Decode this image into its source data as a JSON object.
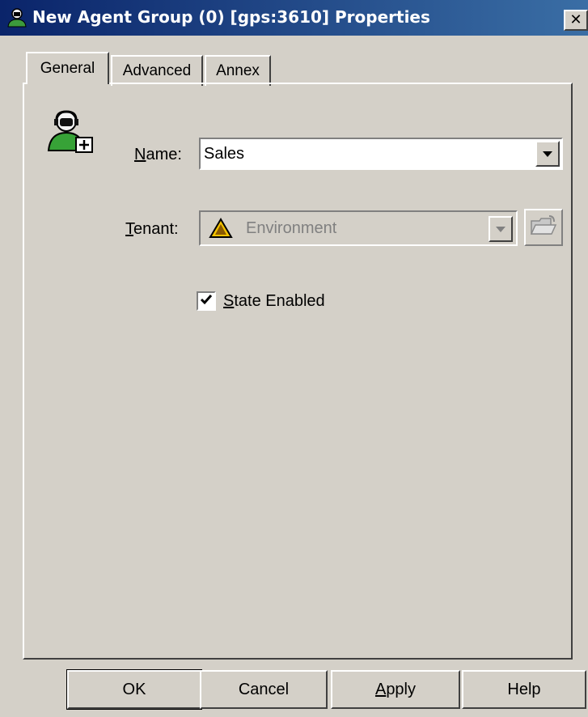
{
  "window": {
    "title": "New Agent Group (0) [gps:3610] Properties",
    "close_glyph": "✕"
  },
  "tabs": [
    {
      "label": "General",
      "selected": true
    },
    {
      "label": "Advanced",
      "selected": false
    },
    {
      "label": "Annex",
      "selected": false
    }
  ],
  "general": {
    "name_label_mnemonic": "N",
    "name_label_rest": "ame:",
    "name_value": "Sales",
    "tenant_label_mnemonic": "T",
    "tenant_label_rest": "enant:",
    "tenant_value": "Environment",
    "tenant_enabled": false,
    "state_enabled_mnemonic": "S",
    "state_enabled_rest": "tate Enabled",
    "state_enabled_checked": true
  },
  "buttons": {
    "ok": "OK",
    "cancel": "Cancel",
    "apply_mnemonic": "A",
    "apply_rest": "pply",
    "help": "Help"
  },
  "icons": {
    "title": "agent-group-icon",
    "agent": "agent-add-icon",
    "tenant": "warning-icon",
    "browse": "folder-open-icon"
  },
  "colors": {
    "title_bar_start": "#0a246a",
    "title_bar_end": "#3a6ea5",
    "face": "#d4d0c8",
    "disabled_text": "#808080"
  }
}
